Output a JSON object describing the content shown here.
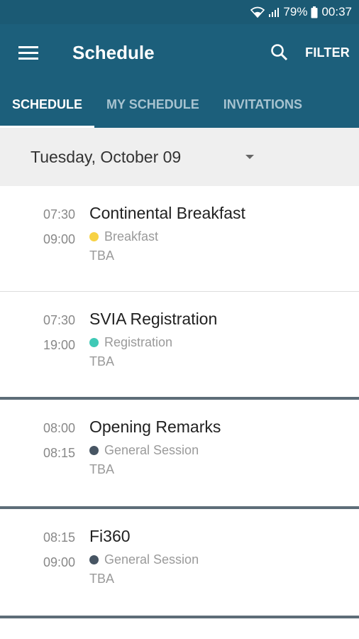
{
  "status_bar": {
    "battery": "79%",
    "time": "00:37"
  },
  "app_bar": {
    "title": "Schedule",
    "filter_label": "FILTER"
  },
  "tabs": [
    {
      "label": "SCHEDULE",
      "active": true
    },
    {
      "label": "MY SCHEDULE",
      "active": false
    },
    {
      "label": "INVITATIONS",
      "active": false
    }
  ],
  "date_selector": {
    "value": "Tuesday, October 09"
  },
  "events": [
    {
      "start": "07:30",
      "end": "09:00",
      "title": "Continental Breakfast",
      "category": "Breakfast",
      "category_color": "#f7d244",
      "location": "TBA"
    },
    {
      "start": "07:30",
      "end": "19:00",
      "title": "SVIA Registration",
      "category": "Registration",
      "category_color": "#3fc9b6",
      "location": "TBA"
    },
    {
      "start": "08:00",
      "end": "08:15",
      "title": "Opening Remarks",
      "category": "General Session",
      "category_color": "#475563",
      "location": "TBA"
    },
    {
      "start": "08:15",
      "end": "09:00",
      "title": "Fi360",
      "category": "General Session",
      "category_color": "#475563",
      "location": "TBA"
    }
  ],
  "colors": {
    "status_bar": "#1b5a74",
    "app_bar": "#1c5f7b",
    "date_bar": "#efefef"
  }
}
